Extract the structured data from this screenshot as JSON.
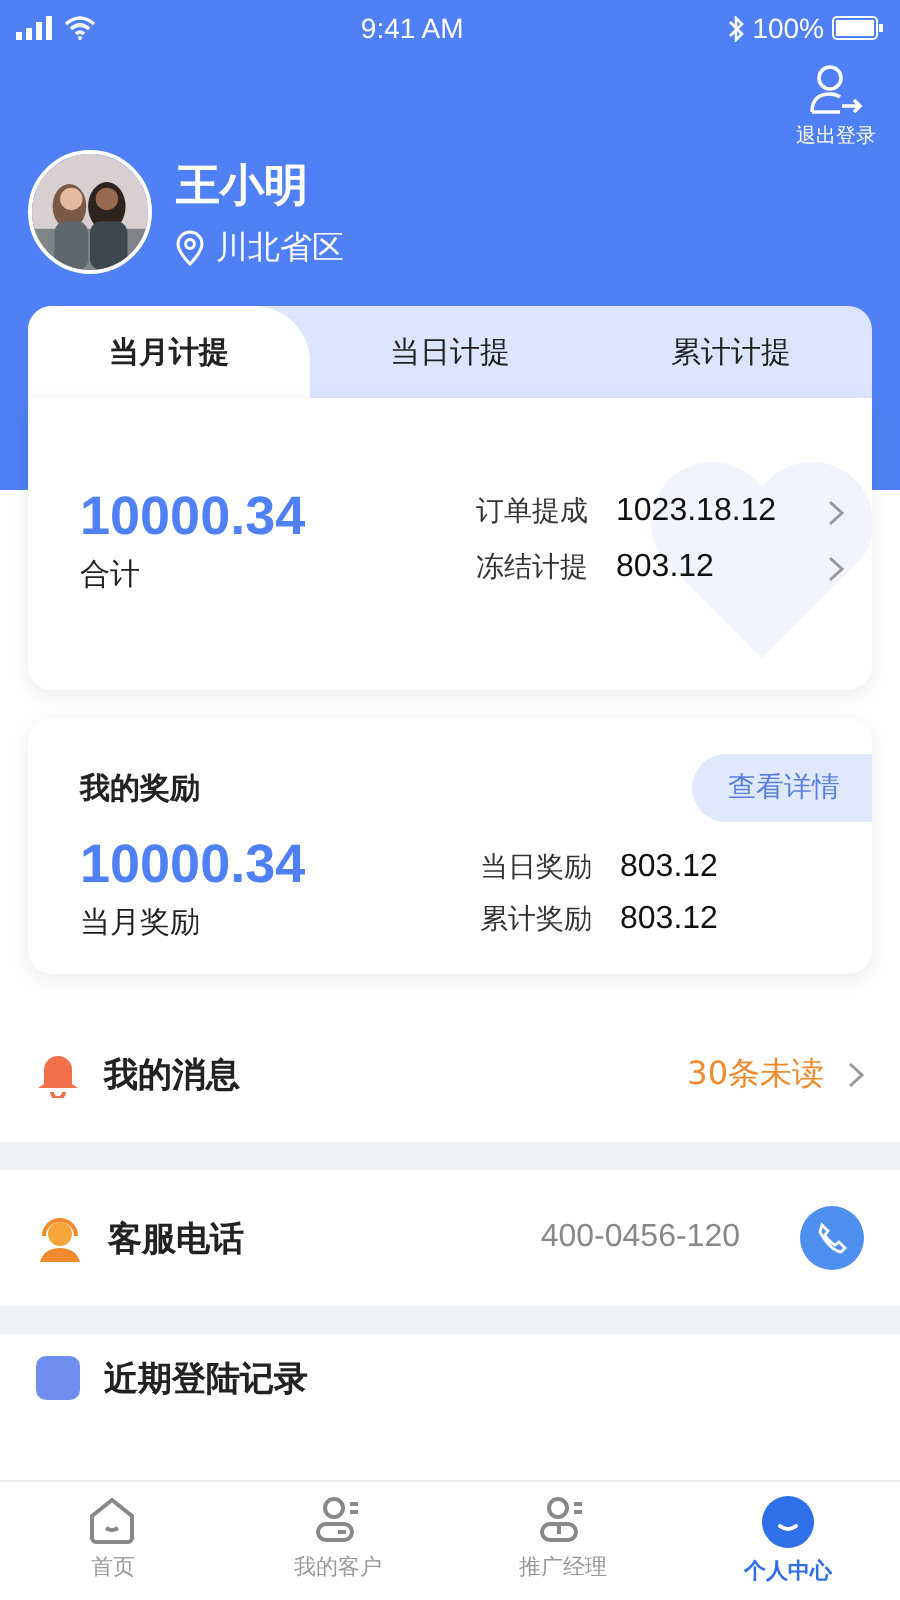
{
  "status_bar": {
    "time": "9:41 AM",
    "battery": "100%"
  },
  "header": {
    "logout_label": "退出登录",
    "name": "王小明",
    "region": "川北省区"
  },
  "tabs": [
    {
      "label": "当月计提",
      "selected": true
    },
    {
      "label": "当日计提",
      "selected": false
    },
    {
      "label": "累计计提",
      "selected": false
    }
  ],
  "summary": {
    "total": "10000.34",
    "total_label": "合计",
    "rows": [
      {
        "label": "订单提成",
        "value": "1023.18.12"
      },
      {
        "label": "冻结计提",
        "value": "803.12"
      }
    ]
  },
  "rewards": {
    "title": "我的奖励",
    "button": "查看详情",
    "total": "10000.34",
    "total_label": "当月奖励",
    "rows": [
      {
        "label": "当日奖励",
        "value": "803.12"
      },
      {
        "label": "累计奖励",
        "value": "803.12"
      }
    ]
  },
  "list": [
    {
      "kind": "message",
      "label": "我的消息",
      "value": "30条未读"
    },
    {
      "kind": "phone",
      "label": "客服电话",
      "value": "400-0456-120"
    },
    {
      "kind": "history",
      "label": "近期登陆记录"
    }
  ],
  "nav": [
    {
      "label": "首页",
      "selected": false
    },
    {
      "label": "我的客户",
      "selected": false
    },
    {
      "label": "推广经理",
      "selected": false
    },
    {
      "label": "个人中心",
      "selected": true
    }
  ]
}
